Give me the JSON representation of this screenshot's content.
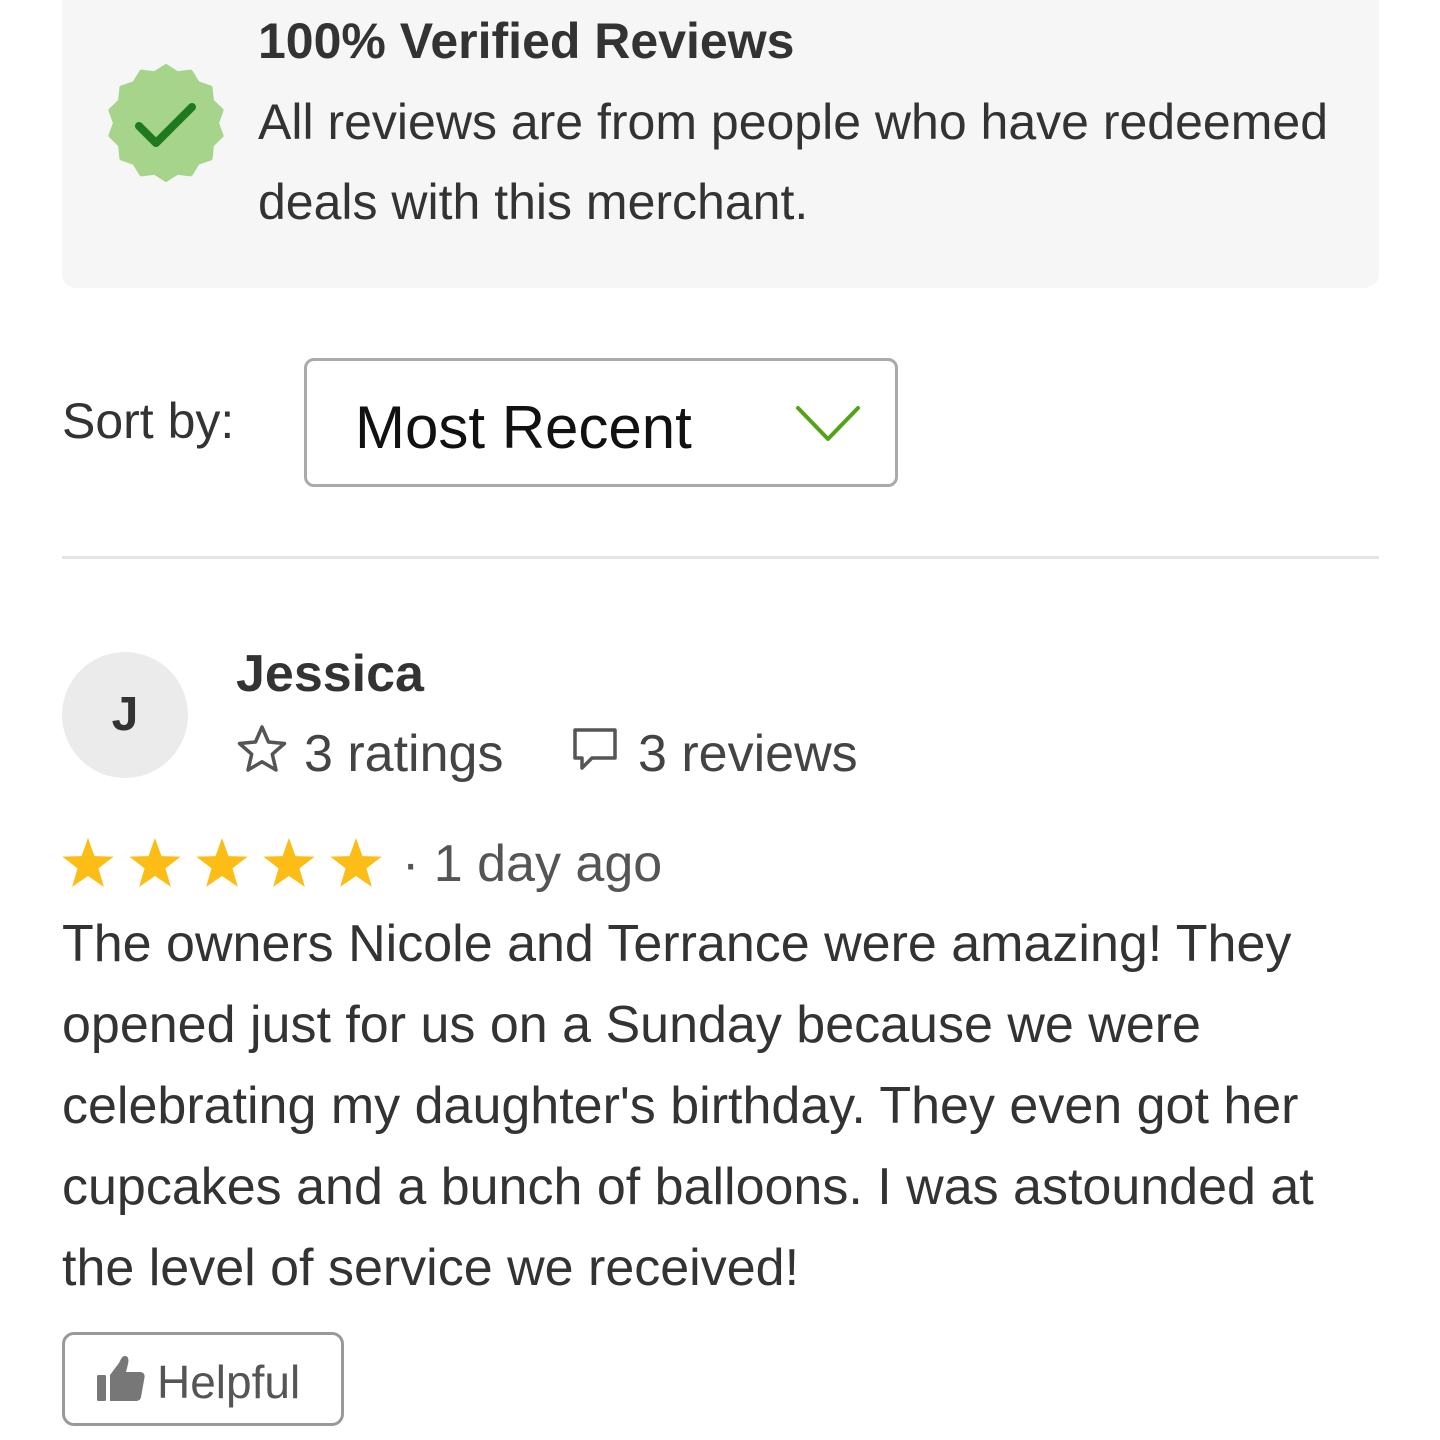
{
  "verified": {
    "title": "100% Verified Reviews",
    "description": "All reviews are from people who have redeemed deals with this merchant.",
    "badge_icon": "verified-check-badge",
    "badge_color": "#a5d48a",
    "check_color": "#1f7a1f"
  },
  "sort": {
    "label": "Sort by:",
    "selected": "Most Recent",
    "chevron_color": "#53a318"
  },
  "review": {
    "avatar_initial": "J",
    "name": "Jessica",
    "ratings": "3 ratings",
    "reviews": "3 reviews",
    "rating": 5,
    "rating_max": 5,
    "star_color": "#fbbd16",
    "time": "· 1 day ago",
    "body": "The owners Nicole and Terrance were amazing! They opened just for us on a Sunday because we were celebrating my daughter's birthday. They even got her cupcakes and a bunch of balloons. I was astounded at the level of service we received!",
    "helpful_label": "Helpful"
  }
}
